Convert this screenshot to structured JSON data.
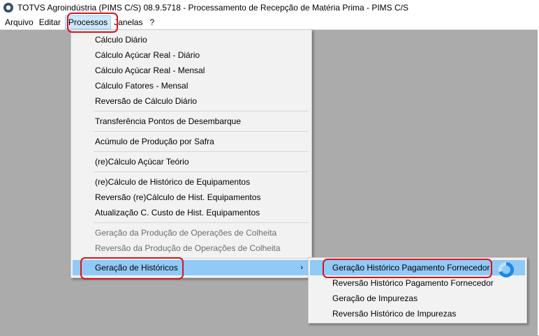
{
  "window": {
    "title": "TOTVS Agroindústria (PIMS C/S) 08.9.5718 - Processamento de Recepção de Matéria Prima - PIMS C/S"
  },
  "menubar": {
    "items": [
      "Arquivo",
      "Editar",
      "Processos",
      "Janelas",
      "?"
    ],
    "active": "Processos"
  },
  "processos_menu": {
    "items": [
      {
        "label": "Cálculo Diário",
        "enabled": true
      },
      {
        "label": "Cálculo Açúcar Real - Diário",
        "enabled": true
      },
      {
        "label": "Cálculo Açúcar Real - Mensal",
        "enabled": true
      },
      {
        "label": "Cálculo Fatores - Mensal",
        "enabled": true
      },
      {
        "label": "Reversão de Cálculo Diário",
        "enabled": true
      },
      {
        "label": "Transferência Pontos de Desembarque",
        "enabled": true
      },
      {
        "label": "Acúmulo de Produção por Safra",
        "enabled": true
      },
      {
        "label": "(re)Cálculo Açúcar Teório",
        "enabled": true
      },
      {
        "label": "(re)Cálculo de Histórico de Equipamentos",
        "enabled": true
      },
      {
        "label": "Reversão (re)Cálculo de Hist. Equipamentos",
        "enabled": true
      },
      {
        "label": "Atualização C. Custo de Hist. Equipamentos",
        "enabled": true
      },
      {
        "label": "Geração da Produção de Operações de Colheita",
        "enabled": false
      },
      {
        "label": "Reversão da Produção de Operações de Colheita",
        "enabled": false
      },
      {
        "label": "Geração de Históricos",
        "enabled": true,
        "submenu": true,
        "highlighted": true
      }
    ],
    "submenu_arrow": "›"
  },
  "historicos_submenu": {
    "items": [
      {
        "label": "Geração Histórico Pagamento Fornecedor",
        "highlighted": true
      },
      {
        "label": "Reversão Histórico Pagamento Fornecedor"
      },
      {
        "label": "Geração de Impurezas"
      },
      {
        "label": "Reversão Histórico de Impurezas"
      }
    ]
  },
  "colors": {
    "workspace": "#ababab",
    "highlight": "#91c9f7",
    "annotation": "#e0101a"
  },
  "icons": {
    "app": "totvs-app-icon",
    "loading": "busy-spinner-icon"
  }
}
